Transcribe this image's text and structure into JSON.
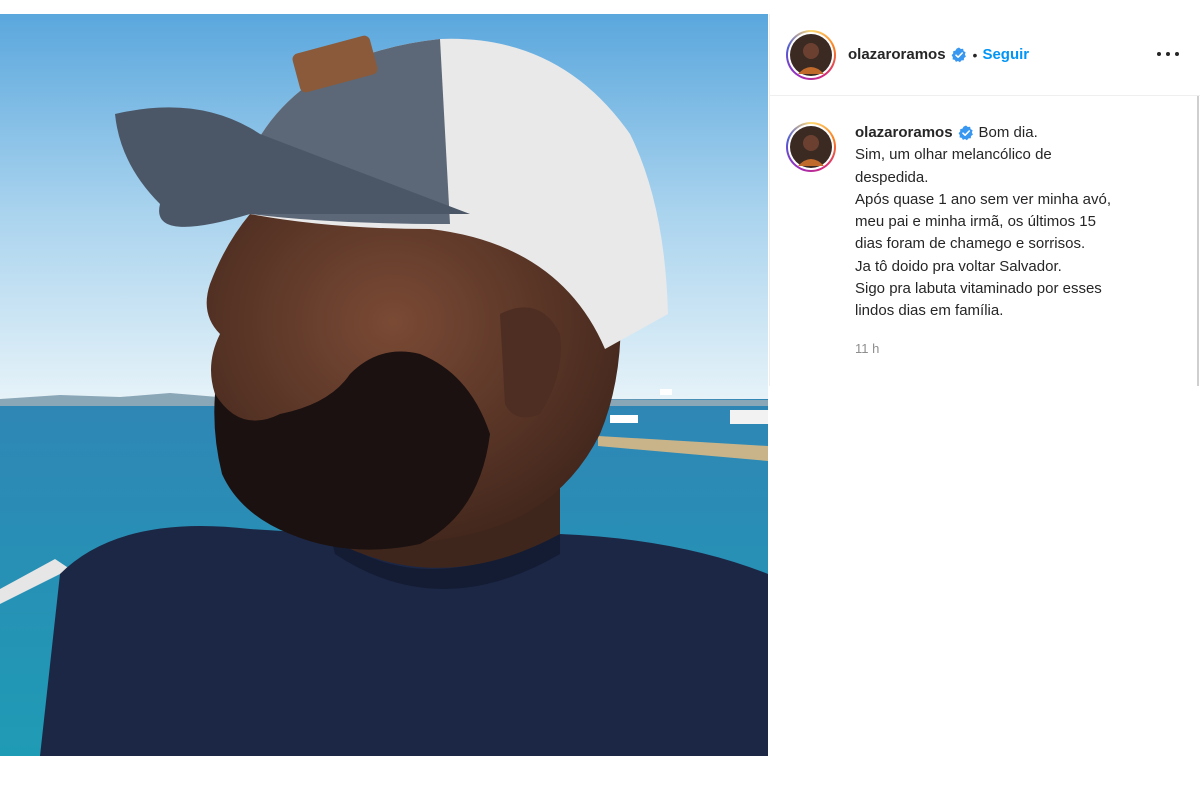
{
  "post": {
    "username": "olazaroramos",
    "follow_label": "Seguir",
    "separator": "•",
    "more_label": "Mais opções",
    "caption_lines": [
      "Bom dia.",
      "Sim, um olhar melancólico de",
      "despedida.",
      "Após quase 1 ano sem ver minha avó,",
      "meu pai e minha irmã, os últimos 15",
      "dias foram de chamego e sorrisos.",
      "Ja tô doido pra voltar Salvador.",
      "Sigo pra labuta vitaminado por esses",
      "lindos dias em família."
    ],
    "timestamp": "11 h"
  },
  "colors": {
    "link_blue": "#0095f6",
    "verified_blue": "#3897f0",
    "text": "#262626",
    "muted": "#8e8e8e"
  },
  "icons": {
    "verified": "verified-badge-icon",
    "more": "more-options-icon"
  }
}
